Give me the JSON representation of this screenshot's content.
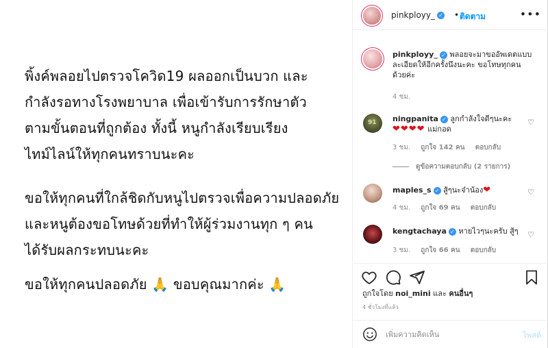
{
  "post": {
    "paragraph1": [
      "พิ้งค์พลอยไปตรวจโควิด19 ผลออกเป็นบวก และ",
      "กำลังรอทางโรงพยาบาล เพื่อเข้ารับการรักษาตัว",
      "ตามขั้นตอนที่ถูกต้อง  ทั้งนี้ หนูกำลังเรียบเรียง",
      "ไทม์ไลน์ให้ทุกคนทราบนะคะ"
    ],
    "paragraph2": [
      "ขอให้ทุกคนที่ใกล้ชิดกับหนูไปตรวจเพื่อความปลอดภัย",
      "และหนูต้องขอโทษด้วยที่ทำให้ผู้ร่วมงานทุก ๆ คน",
      "ได้รับผลกระทบนะคะ"
    ],
    "paragraph3": "ขอให้ทุกคนปลอดภัย 🙏 ขอบคุณมากค่ะ 🙏"
  },
  "header": {
    "username": "pinkployy_",
    "dot": "•",
    "follow_label": "ติดตาม",
    "more": "•••"
  },
  "caption": {
    "username": "pinkployy_",
    "text": "พลอยจะมาขออัพเดตแบบละเอียดให้อีกครั้งนึงนะคะ ขอโทษทุกคนด้วยค่ะ",
    "time": "4 ชม."
  },
  "comments": [
    {
      "username": "ningpanita",
      "text": "ลูกกำลังใจดีๆนะคะ",
      "hearts": "❤❤❤❤",
      "text2": "แม่กอด",
      "time": "3 ชม.",
      "likes": "ถูกใจ 142 คน",
      "reply": "ตอบกลับ",
      "view_replies": "ดูข้อความตอบกลับ (2 รายการ)",
      "avatar_text": "91"
    },
    {
      "username": "maples_s",
      "text": "สู้ๆนะจ๋าน้อง",
      "hearts": "❤",
      "time": "4 ชม.",
      "likes": "ถูกใจ 69 คน",
      "reply": "ตอบกลับ"
    },
    {
      "username": "kengtachaya",
      "text": "หายไวๆนะครับ สู้ๆ",
      "time": "3 ชม.",
      "likes": "ถูกใจ 66 คน",
      "reply": "ตอบกลับ"
    }
  ],
  "likes": {
    "prefix": "ถูกใจโดย",
    "user": "noi_mini",
    "mid": "และ",
    "others": "คนอื่นๆ"
  },
  "timestamp": "4 ชั่วโมงที่แล้ว",
  "add_comment": {
    "placeholder": "เพิ่มความคิดเห็น",
    "post_label": "โพสต์"
  },
  "icons": [
    "heart-icon",
    "comment-icon",
    "share-icon",
    "bookmark-icon",
    "emoji-icon",
    "verified-icon",
    "more-icon"
  ],
  "colors": {
    "follow": "#0095f6",
    "verified": "#3897f0",
    "heart": "#e0111b",
    "muted": "#8e8e8e"
  }
}
